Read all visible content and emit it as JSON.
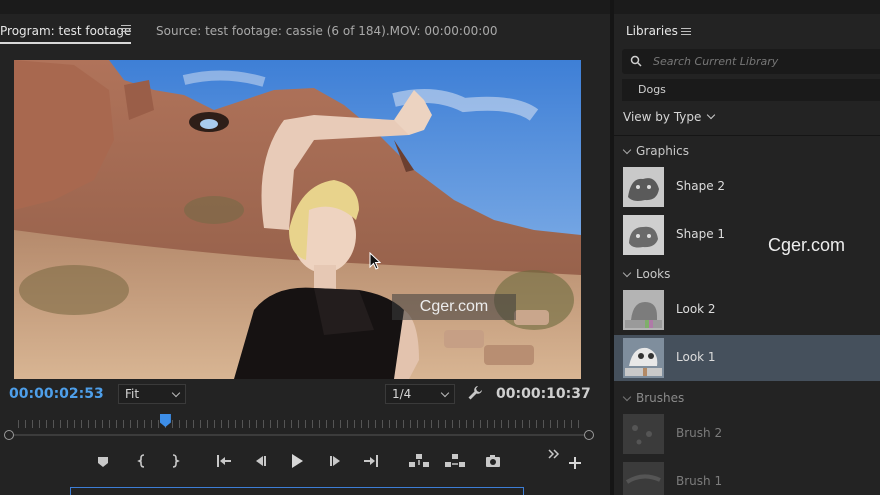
{
  "program_monitor": {
    "tab_program": "Program: test footage",
    "tab_source": "Source: test footage: cassie (6 of 184).MOV: 00:00:00:00",
    "video_watermark": "Cger.com",
    "current_time": "00:00:02:53",
    "zoom_value": "Fit",
    "resolution_value": "1/4",
    "duration": "00:00:10:37",
    "playhead_progress": 0.26,
    "transport_icons": [
      "add-marker-icon",
      "mark-in-icon",
      "mark-out-icon",
      "go-to-in-icon",
      "step-back-icon",
      "play-icon",
      "step-forward-icon",
      "go-to-out-icon",
      "lift-icon",
      "extract-icon",
      "export-frame-icon",
      "more-icon",
      "add-button-icon"
    ],
    "accent_color": "#4e9fea"
  },
  "libraries": {
    "title": "Libraries",
    "search_placeholder": "Search Current Library",
    "library_name": "Dogs",
    "view_by": "View by Type",
    "watermark": "Cger.com",
    "sections": [
      {
        "name": "Graphics",
        "items": [
          "Shape 2",
          "Shape 1"
        ]
      },
      {
        "name": "Looks",
        "items": [
          "Look 2",
          "Look 1"
        ],
        "selected": "Look 1"
      },
      {
        "name": "Brushes",
        "items": [
          "Brush 2",
          "Brush 1"
        ]
      }
    ]
  }
}
